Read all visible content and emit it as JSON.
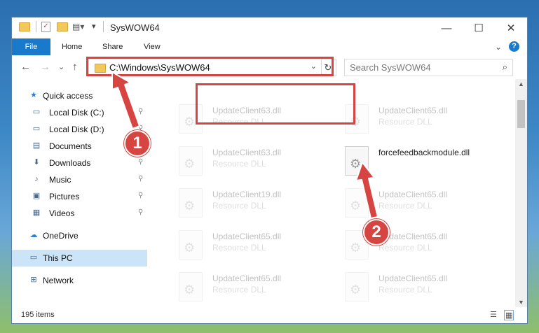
{
  "window": {
    "title": "SysWOW64",
    "controls": {
      "minimize": "—",
      "maximize": "☐",
      "close": "✕"
    }
  },
  "ribbon": {
    "tabs": [
      "File",
      "Home",
      "Share",
      "View"
    ],
    "expand": "⌄",
    "help": "?"
  },
  "nav": {
    "back": "←",
    "forward": "→",
    "recent": "⌄",
    "up": "↑",
    "address": "C:\\Windows\\SysWOW64",
    "address_dropdown": "⌄",
    "refresh": "↻",
    "search_placeholder": "Search SysWOW64",
    "search_icon": "⌕"
  },
  "sidebar": {
    "items": [
      {
        "label": "Quick access",
        "icon": "star-icon",
        "glyph": "★",
        "pinned": false
      },
      {
        "label": "Local Disk (C:)",
        "icon": "drive-icon",
        "glyph": "▭",
        "pinned": true
      },
      {
        "label": "Local Disk (D:)",
        "icon": "drive-icon",
        "glyph": "▭",
        "pinned": true
      },
      {
        "label": "Documents",
        "icon": "documents-icon",
        "glyph": "▤",
        "pinned": true
      },
      {
        "label": "Downloads",
        "icon": "downloads-icon",
        "glyph": "⬇",
        "pinned": true
      },
      {
        "label": "Music",
        "icon": "music-icon",
        "glyph": "♪",
        "pinned": true
      },
      {
        "label": "Pictures",
        "icon": "pictures-icon",
        "glyph": "▣",
        "pinned": true
      },
      {
        "label": "Videos",
        "icon": "videos-icon",
        "glyph": "▦",
        "pinned": true
      },
      {
        "label": "OneDrive",
        "icon": "cloud-icon",
        "glyph": "☁",
        "pinned": false
      },
      {
        "label": "This PC",
        "icon": "computer-icon",
        "glyph": "▭",
        "pinned": false,
        "selected": true
      },
      {
        "label": "Network",
        "icon": "network-icon",
        "glyph": "⊞",
        "pinned": false
      }
    ],
    "pin_glyph": "📌"
  },
  "files": [
    {
      "name": "UpdateClient63.dll",
      "type": "Resource DLL",
      "faded": true
    },
    {
      "name": "UpdateClient65.dll",
      "type": "Resource DLL",
      "faded": true
    },
    {
      "name": "UpdateClient63.dll",
      "type": "Resource DLL",
      "faded": true
    },
    {
      "name": "forcefeedbackmodule.dll",
      "type": "",
      "faded": false
    },
    {
      "name": "UpdateClient19.dll",
      "type": "Resource DLL",
      "faded": true
    },
    {
      "name": "UpdateClient65.dll",
      "type": "Resource DLL",
      "faded": true
    },
    {
      "name": "UpdateClient65.dll",
      "type": "Resource DLL",
      "faded": true
    },
    {
      "name": "UpdateClient65.dll",
      "type": "Resource DLL",
      "faded": true
    },
    {
      "name": "UpdateClient65.dll",
      "type": "Resource DLL",
      "faded": true
    },
    {
      "name": "UpdateClient65.dll",
      "type": "Resource DLL",
      "faded": true
    }
  ],
  "status": {
    "item_count": "195 items",
    "details_view": "☰",
    "tiles_view": "▦"
  },
  "callouts": {
    "step1": "1",
    "step2": "2"
  },
  "colors": {
    "accent": "#1979ca",
    "highlight": "#d64541",
    "selected": "#cce4f7"
  }
}
